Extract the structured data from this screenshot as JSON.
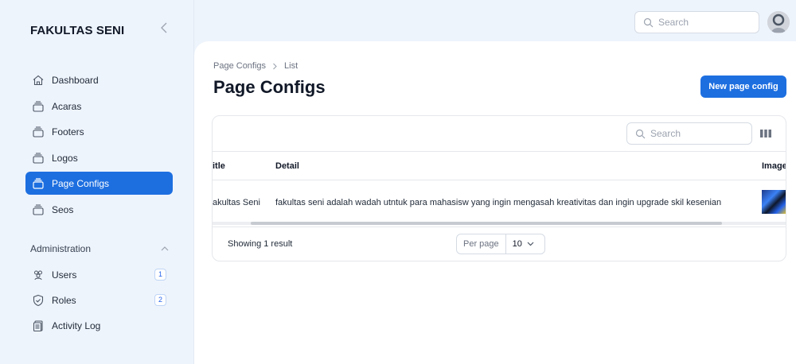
{
  "brand": {
    "title": "FAKULTAS SENI"
  },
  "sidebar": {
    "items": [
      {
        "label": "Dashboard",
        "icon": "home-icon"
      },
      {
        "label": "Acaras",
        "icon": "rectangle-stack-icon"
      },
      {
        "label": "Footers",
        "icon": "rectangle-stack-icon"
      },
      {
        "label": "Logos",
        "icon": "rectangle-stack-icon"
      },
      {
        "label": "Page Configs",
        "icon": "rectangle-stack-icon",
        "active": true
      },
      {
        "label": "Seos",
        "icon": "rectangle-stack-icon"
      }
    ],
    "group": {
      "label": "Administration",
      "items": [
        {
          "label": "Users",
          "icon": "users-icon",
          "badge": "1"
        },
        {
          "label": "Roles",
          "icon": "shield-check-icon",
          "badge": "2"
        },
        {
          "label": "Activity Log",
          "icon": "clipboard-document-icon"
        }
      ]
    }
  },
  "topbar": {
    "search_placeholder": "Search"
  },
  "main": {
    "breadcrumb": [
      "Page Configs",
      "List"
    ],
    "title": "Page Configs",
    "new_button": "New page config",
    "table": {
      "search_placeholder": "Search",
      "columns": [
        "itle",
        "Detail",
        "Image"
      ],
      "rows": [
        {
          "title": "akultas Seni",
          "detail": "fakultas seni adalah wadah utntuk para mahasisw yang ingin mengasah kreativitas dan ingin upgrade skil kesenian"
        }
      ],
      "footer": {
        "result_text": "Showing 1 result",
        "per_page_label": "Per page",
        "per_page_value": "10"
      }
    }
  },
  "colors": {
    "accent": "#1d6fe0",
    "background": "#eef4fc"
  }
}
